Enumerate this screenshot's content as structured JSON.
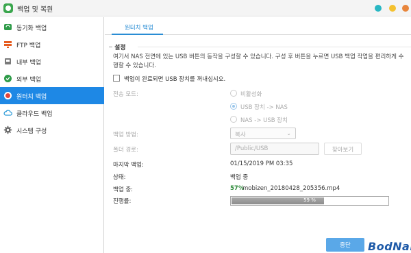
{
  "window": {
    "title": "백업 및 복원",
    "buttons": [
      {
        "name": "minimize",
        "color": "#29b7c3"
      },
      {
        "name": "maximize",
        "color": "#f4c12f"
      },
      {
        "name": "close",
        "color": "#e8853b"
      }
    ]
  },
  "sidebar": {
    "items": [
      {
        "label": "동기화 백업",
        "icon": "sync-icon",
        "color": "#2e9b48"
      },
      {
        "label": "FTP 백업",
        "icon": "ftp-icon",
        "color": "#e65c1f"
      },
      {
        "label": "내부 백업",
        "icon": "internal-backup-icon",
        "color": "#7a7a7a"
      },
      {
        "label": "외부 백업",
        "icon": "external-backup-icon",
        "color": "#2e9b48"
      },
      {
        "label": "원터치 백업",
        "icon": "one-touch-icon",
        "color": "#e0443c",
        "active": true
      },
      {
        "label": "클라우드 백업",
        "icon": "cloud-icon",
        "color": "#2a9ad8"
      },
      {
        "label": "시스템 구성",
        "icon": "gear-icon",
        "color": "#666666"
      }
    ]
  },
  "tab": {
    "label": "원터치 백업"
  },
  "settings": {
    "title": "설정",
    "description": "여기서 NAS 전면에 있는 USB 버튼의 동작을 구성할 수 있습니다. 구성 후 버튼을 누르면 USB 백업 작업을 편리하게 수행할 수 있습니다.",
    "eject_checkbox_label": "백업이 완료되면 USB 장치를 꺼내십시오.",
    "transfer_mode_label": "전송 모드:",
    "transfer_modes": [
      "비활성화",
      "USB 장치 -> NAS",
      "NAS -> USB 장치"
    ],
    "selected_mode_index": 1,
    "backup_method_label": "백업 방법:",
    "backup_method_value": "복사",
    "folder_path_label": "폴더 경로:",
    "folder_path_value": "/Public/USB",
    "browse_label": "찾아보기",
    "last_backup_label": "마지막 백업:",
    "last_backup_value": "01/15/2019 PM 03:35",
    "status_label": "상태:",
    "status_value": "백업 중",
    "backing_up_label": "백업 중:",
    "backing_up_percent": "57%",
    "backing_up_file": "mobizen_20180428_205356.mp4",
    "progress_label": "진행률:",
    "progress_text": "59 %",
    "progress_fraction": 0.59
  },
  "footer": {
    "stop_label": "중단"
  },
  "watermark": "BodNara"
}
